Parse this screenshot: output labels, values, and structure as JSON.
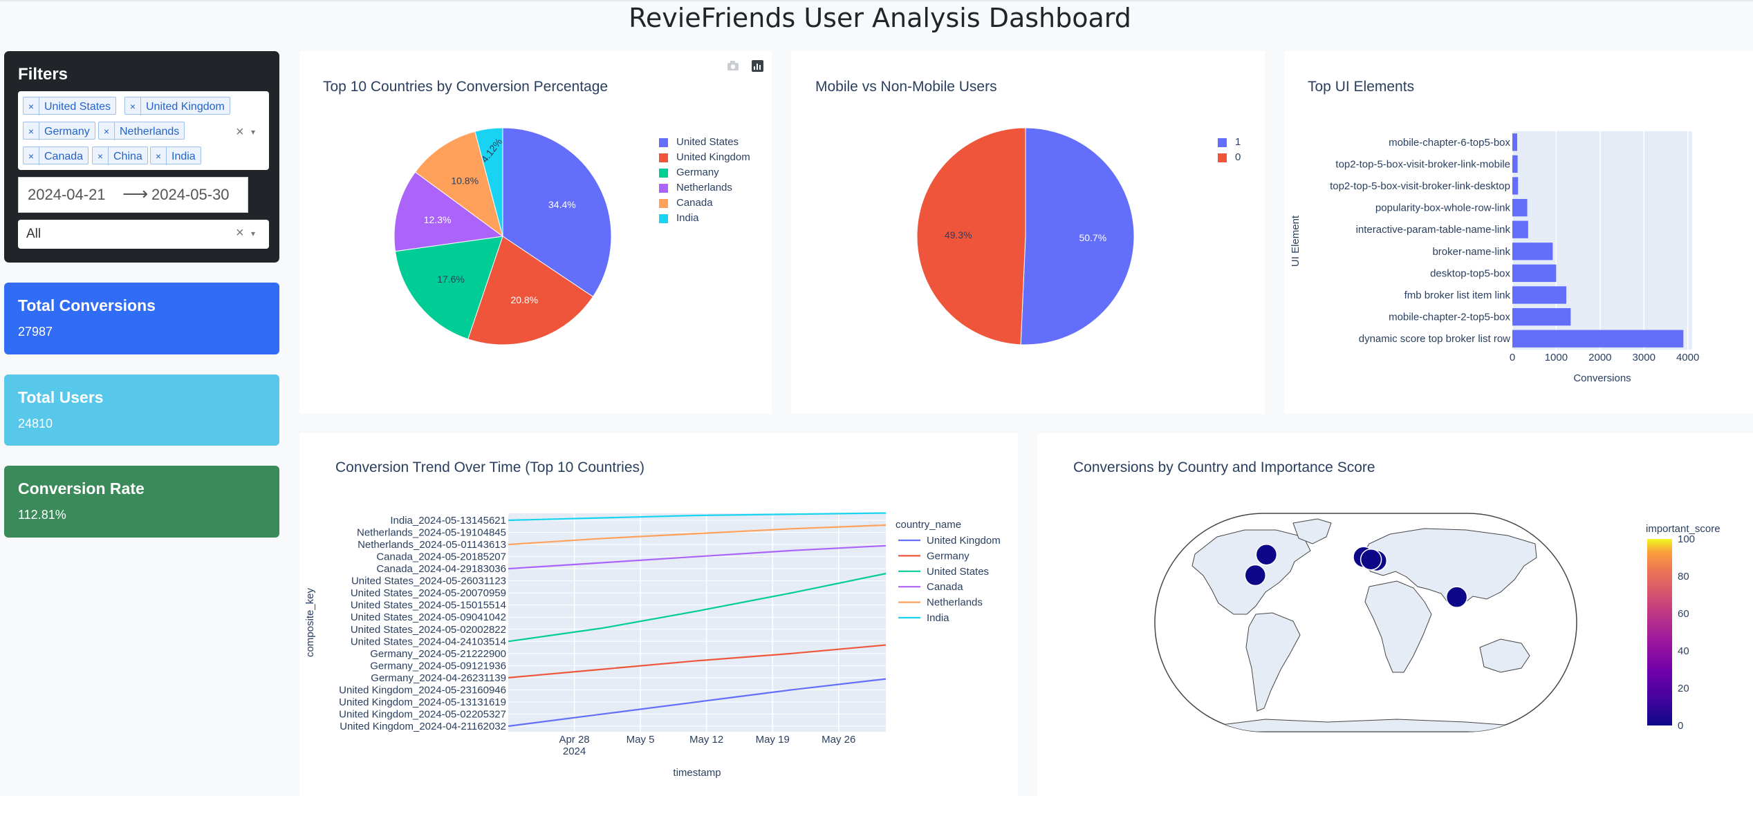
{
  "title": "RevieFriends User Analysis Dashboard",
  "filters": {
    "title": "Filters",
    "countries": [
      "United States",
      "United Kingdom",
      "Germany",
      "Netherlands",
      "Canada",
      "China",
      "India"
    ],
    "start_date": "2024-04-21",
    "end_date": "2024-05-30",
    "arrow": "⟶",
    "dropdown_value": "All",
    "clear_symbol": "×",
    "caret_symbol": "▾",
    "remove_symbol": "×"
  },
  "cards": {
    "conversions": {
      "label": "Total Conversions",
      "value": "27987",
      "color": "#316cf4"
    },
    "users": {
      "label": "Total Users",
      "value": "24810",
      "color": "#57c7ea"
    },
    "rate": {
      "label": "Conversion Rate",
      "value": "112.81%",
      "color": "#3b8a5a"
    }
  },
  "modebar": {
    "camera_icon": "camera-icon",
    "plotly_logo": "plotly-logo-icon"
  },
  "pie1": {
    "title": "Top 10 Countries by Conversion Percentage",
    "chart_data": {
      "type": "pie",
      "labels": [
        "United States",
        "United Kingdom",
        "Germany",
        "Netherlands",
        "Canada",
        "India"
      ],
      "values": [
        34.4,
        20.8,
        17.6,
        12.3,
        10.8,
        4.12
      ],
      "display_labels": [
        "34.4%",
        "20.8%",
        "17.6%",
        "12.3%",
        "10.8%",
        "4.12%"
      ],
      "colors": [
        "#636efa",
        "#ef553b",
        "#00cc96",
        "#ab63fa",
        "#ffa15a",
        "#19d3f3"
      ],
      "legend": "top-right"
    }
  },
  "pie2": {
    "title": "Mobile vs Non-Mobile Users",
    "chart_data": {
      "type": "pie",
      "labels": [
        "1",
        "0"
      ],
      "values": [
        50.7,
        49.3
      ],
      "display_labels": [
        "50.7%",
        "49.3%"
      ],
      "colors": [
        "#636efa",
        "#ef553b"
      ],
      "legend": "top-right"
    }
  },
  "bars": {
    "title": "Top UI Elements",
    "chart_data": {
      "type": "bar",
      "orientation": "horizontal",
      "categories": [
        "mobile-chapter-6-top5-box",
        "top2-top-5-box-visit-broker-link-mobile",
        "top2-top-5-box-visit-broker-link-desktop",
        "popularity-box-whole-row-link",
        "interactive-param-table-name-link",
        "broker-name-link",
        "desktop-top5-box",
        "fmb broker list item link",
        "mobile-chapter-2-top5-box",
        "dynamic score top broker list row"
      ],
      "values": [
        110,
        120,
        130,
        340,
        360,
        920,
        1000,
        1230,
        1330,
        3900
      ],
      "xlabel": "Conversions",
      "ylabel": "UI Element",
      "xlim": [
        0,
        4100
      ],
      "xticks": [
        0,
        1000,
        2000,
        3000,
        4000
      ],
      "xtick_labels": [
        "0",
        "1000",
        "2000",
        "3000",
        "4000"
      ],
      "color": "#636efa",
      "grid": true
    }
  },
  "trend": {
    "title": "Conversion Trend Over Time (Top 10 Countries)",
    "chart_data": {
      "type": "line",
      "xlabel": "timestamp",
      "ylabel": "composite_key",
      "legend_title": "country_name",
      "x_range": [
        "2024-04-21",
        "2024-05-31"
      ],
      "x_ticks": [
        "2024-04-28",
        "2024-05-05",
        "2024-05-12",
        "2024-05-19",
        "2024-05-26"
      ],
      "x_tick_labels": [
        "Apr 28",
        "May 5",
        "May 12",
        "May 19",
        "May 26"
      ],
      "x_tick_year": "2024",
      "y_labels": [
        "United Kingdom_2024-04-21162032",
        "United Kingdom_2024-05-02205327",
        "United Kingdom_2024-05-13131619",
        "United Kingdom_2024-05-23160946",
        "Germany_2024-04-26231139",
        "Germany_2024-05-09121936",
        "Germany_2024-05-21222900",
        "United States_2024-04-24103514",
        "United States_2024-05-02002822",
        "United States_2024-05-09041042",
        "United States_2024-05-15015514",
        "United States_2024-05-20070959",
        "United States_2024-05-26031123",
        "Canada_2024-04-29183036",
        "Canada_2024-05-20185207",
        "Netherlands_2024-05-01143613",
        "Netherlands_2024-05-19104845",
        "India_2024-05-13145621"
      ],
      "series": [
        {
          "name": "United Kingdom",
          "color": "#636efa",
          "x": [
            "2024-04-21",
            "2024-05-01",
            "2024-05-11",
            "2024-05-21",
            "2024-05-31"
          ],
          "y": [
            0.0,
            1.0,
            2.0,
            3.0,
            3.9
          ]
        },
        {
          "name": "Germany",
          "color": "#ef553b",
          "x": [
            "2024-04-21",
            "2024-05-01",
            "2024-05-11",
            "2024-05-21",
            "2024-05-31"
          ],
          "y": [
            4.0,
            4.7,
            5.4,
            6.0,
            6.7
          ]
        },
        {
          "name": "United States",
          "color": "#00cc96",
          "x": [
            "2024-04-21",
            "2024-05-01",
            "2024-05-11",
            "2024-05-21",
            "2024-05-31"
          ],
          "y": [
            7.0,
            8.1,
            9.5,
            11.0,
            12.6
          ]
        },
        {
          "name": "Canada",
          "color": "#ab63fa",
          "x": [
            "2024-04-21",
            "2024-05-01",
            "2024-05-11",
            "2024-05-21",
            "2024-05-31"
          ],
          "y": [
            13.0,
            13.5,
            14.0,
            14.5,
            14.9
          ]
        },
        {
          "name": "Netherlands",
          "color": "#ffa15a",
          "x": [
            "2024-04-21",
            "2024-05-01",
            "2024-05-11",
            "2024-05-21",
            "2024-05-31"
          ],
          "y": [
            15.0,
            15.5,
            15.9,
            16.3,
            16.6
          ]
        },
        {
          "name": "India",
          "color": "#19d3f3",
          "x": [
            "2024-04-21",
            "2024-05-01",
            "2024-05-11",
            "2024-05-21",
            "2024-05-31"
          ],
          "y": [
            17.0,
            17.2,
            17.4,
            17.5,
            17.6
          ]
        }
      ]
    }
  },
  "map": {
    "title": "Conversions by Country and Importance Score",
    "colorbar_title": "important_score",
    "colorbar_ticks": [
      "100",
      "80",
      "60",
      "40",
      "20",
      "0"
    ],
    "chart_data": {
      "type": "scatter",
      "projection": "natural earth",
      "points": [
        {
          "lon": -100,
          "lat": 39,
          "score": 0
        },
        {
          "lon": -96,
          "lat": 56,
          "score": 0
        },
        {
          "lon": -2,
          "lat": 54,
          "score": 0
        },
        {
          "lon": 10,
          "lat": 51,
          "score": 0
        },
        {
          "lon": 5,
          "lat": 52,
          "score": 0
        },
        {
          "lon": 79,
          "lat": 21,
          "score": 0
        }
      ],
      "marker_color": "#0d0887"
    }
  }
}
